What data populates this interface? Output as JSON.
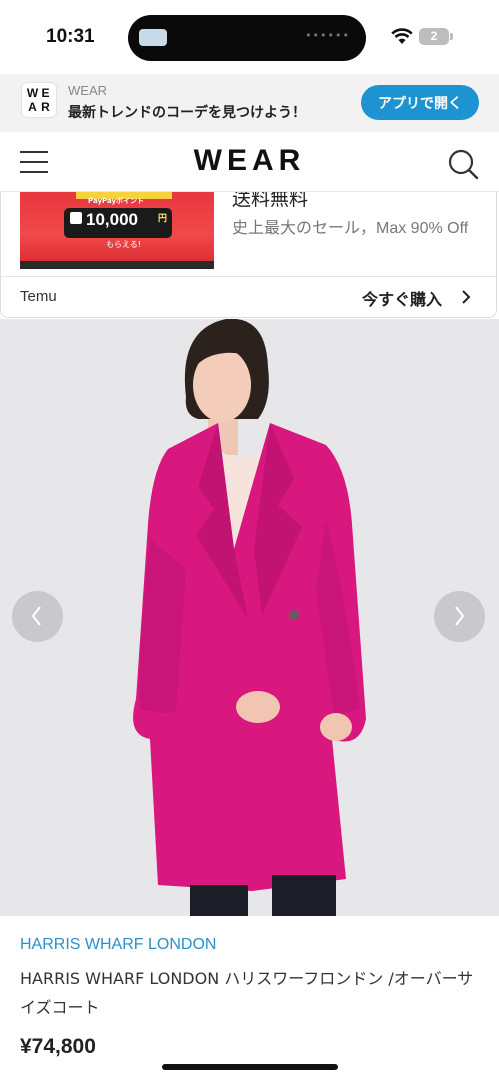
{
  "status_bar": {
    "time": "10:31",
    "battery": "2"
  },
  "app_banner": {
    "logo_letters": [
      "W",
      "E",
      "A",
      "R"
    ],
    "app_name": "WEAR",
    "tagline": "最新トレンドのコーデを見つけよう！",
    "open_button": "アプリで開く"
  },
  "header": {
    "logo": "WEAR"
  },
  "ad": {
    "image_sub": "PayPayポイント",
    "image_amount": "10,000",
    "image_unit": "円",
    "image_plus": "もらえる!",
    "title": "送料無料",
    "description": "史上最大のセール，Max 90% Off",
    "advertiser": "Temu",
    "cta": "今すぐ購入"
  },
  "product": {
    "brand": "HARRIS WHARF LONDON",
    "name": "HARRIS WHARF LONDON ハリスワーフロンドン /オーバーサイズコート",
    "price": "¥74,800"
  },
  "colors": {
    "accent": "#1e93d2",
    "brand_link": "#2a8fc8",
    "coat": "#d8177f"
  }
}
